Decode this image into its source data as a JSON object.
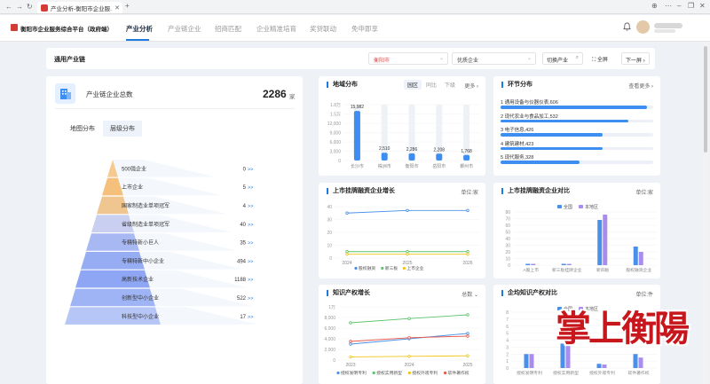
{
  "browser": {
    "tab_title": "产业分析-衡阳市企业服..."
  },
  "header": {
    "brand": "衡阳市企业服务综合平台（政府端）",
    "nav": [
      "产业分析",
      "产业链企业",
      "招商匹配",
      "企业精准培育",
      "奖贷联动",
      "免申即享"
    ]
  },
  "chain_bar": {
    "title": "通用产业链",
    "city": "衡阳市",
    "enterprise_type": "优质企业",
    "switch_label": "切换产业",
    "fullscreen_label": "全屏",
    "next_screen_label": "下一屏"
  },
  "total_card": {
    "title": "产业链企业总数",
    "value": "2286",
    "unit": "家",
    "tabs": [
      "地图分布",
      "层级分布"
    ],
    "tiers": [
      {
        "label": "500强企业",
        "count": "0"
      },
      {
        "label": "上市企业",
        "count": "5"
      },
      {
        "label": "国家制造业单项冠军",
        "count": "4"
      },
      {
        "label": "省级制造业单项冠军",
        "count": "40"
      },
      {
        "label": "专精特新小巨人",
        "count": "35"
      },
      {
        "label": "专精特新中小企业",
        "count": "494"
      },
      {
        "label": "高新技术企业",
        "count": "1188"
      },
      {
        "label": "创新型中小企业",
        "count": "522"
      },
      {
        "label": "科技型中小企业",
        "count": "17"
      }
    ],
    "arrow": ">>"
  },
  "region_card": {
    "title": "地域分布",
    "tabs": [
      "园区",
      "同比",
      "下级"
    ],
    "more": "更多"
  },
  "segment_card": {
    "title": "环节分布",
    "more": "查看更多",
    "items": [
      {
        "rank": "1",
        "label": "通用设备与仪器仪表,606",
        "ratio": 0.96
      },
      {
        "rank": "2",
        "label": "现代农业与食品加工,532",
        "ratio": 0.84
      },
      {
        "rank": "3",
        "label": "电子信息,426",
        "ratio": 0.67
      },
      {
        "rank": "4",
        "label": "建筑建材,423",
        "ratio": 0.67
      },
      {
        "rank": "5",
        "label": "现代服务,328",
        "ratio": 0.52
      }
    ]
  },
  "listing_growth_card": {
    "title": "上市挂牌融资企业增长",
    "unit": "单位:家"
  },
  "listing_compare_card": {
    "title": "上市挂牌融资企业对比",
    "unit": "单位:家"
  },
  "ip_growth_card": {
    "title": "知识产权增长",
    "selector": "总数"
  },
  "ip_compare_card": {
    "title": "企均知识产权对比",
    "unit": "单位:件"
  },
  "watermark": "掌上衡陽",
  "colors": {
    "primary": "#1f7ae0",
    "bar": "#3d8ef0",
    "compare_local": "#a98cf0",
    "compare_all": "#4a90e8"
  },
  "chart_data": [
    {
      "type": "bar",
      "title": "地域分布",
      "categories": [
        "长沙市",
        "株洲市",
        "衡阳市",
        "岳阳市",
        "郴州市"
      ],
      "values": [
        15982,
        2510,
        2286,
        2208,
        1768
      ],
      "value_labels": [
        "15,982",
        "2,510",
        "2,286",
        "2,208",
        "1,768"
      ],
      "yticks": [
        "0",
        "3,000",
        "6,000",
        "9,000",
        "12,000",
        "1.5万",
        "1.8万"
      ],
      "ylim": [
        0,
        18000
      ]
    },
    {
      "type": "line",
      "title": "上市挂牌融资企业增长",
      "x": [
        "2024",
        "2025",
        "2026"
      ],
      "series": [
        {
          "name": "股权融资",
          "values": [
            35,
            37,
            37
          ],
          "color": "#4a90e8"
        },
        {
          "name": "新三板",
          "values": [
            5,
            5,
            5
          ],
          "color": "#5cc46a"
        },
        {
          "name": "上市企业",
          "values": [
            3,
            3,
            3
          ],
          "color": "#f0c419"
        }
      ],
      "yticks": [
        "0",
        "10",
        "20",
        "30",
        "40"
      ],
      "ylim": [
        0,
        40
      ]
    },
    {
      "type": "bar",
      "title": "上市挂牌融资企业对比",
      "categories": [
        "A股上市",
        "新三板挂牌企业",
        "新四板",
        "股权融资企业"
      ],
      "series": [
        {
          "name": "全国",
          "values": [
            2,
            2,
            68,
            28
          ],
          "color": "#4a90e8"
        },
        {
          "name": "本地区",
          "values": [
            2,
            2,
            76,
            20
          ],
          "color": "#a98cf0"
        }
      ],
      "yticks": [
        "0",
        "10",
        "20",
        "30",
        "40",
        "50",
        "60",
        "70",
        "80"
      ],
      "ylim": [
        0,
        80
      ]
    },
    {
      "type": "line",
      "title": "知识产权增长",
      "x": [
        "2023",
        "2024",
        "2025"
      ],
      "series": [
        {
          "name": "授权发明专利",
          "values": [
            3000,
            4000,
            5000
          ],
          "color": "#4a90e8"
        },
        {
          "name": "授权实用新型",
          "values": [
            7000,
            7800,
            8500
          ],
          "color": "#5cc46a"
        },
        {
          "name": "授权外观专利",
          "values": [
            600,
            700,
            800
          ],
          "color": "#f0c419"
        },
        {
          "name": "软件著作权",
          "values": [
            3500,
            4200,
            4500
          ],
          "color": "#e8584a"
        }
      ],
      "yticks": [
        "0",
        "2,000",
        "4,000",
        "6,000",
        "8,000",
        "1万"
      ],
      "ylim": [
        0,
        10000
      ]
    },
    {
      "type": "bar",
      "title": "企均知识产权对比",
      "categories": [
        "授权发明专利",
        "授权实用新型",
        "授权外观专利",
        "软件著作权"
      ],
      "series": [
        {
          "name": "全国",
          "values": [
            2,
            3.5,
            0.6,
            2
          ],
          "color": "#4a90e8"
        },
        {
          "name": "本地区",
          "values": [
            2,
            3.3,
            0.5,
            1.5
          ],
          "color": "#a98cf0"
        }
      ],
      "yticks": [
        "0",
        "1",
        "2",
        "3",
        "4",
        "5",
        "6",
        "7",
        "8"
      ],
      "ylim": [
        0,
        8
      ]
    }
  ]
}
